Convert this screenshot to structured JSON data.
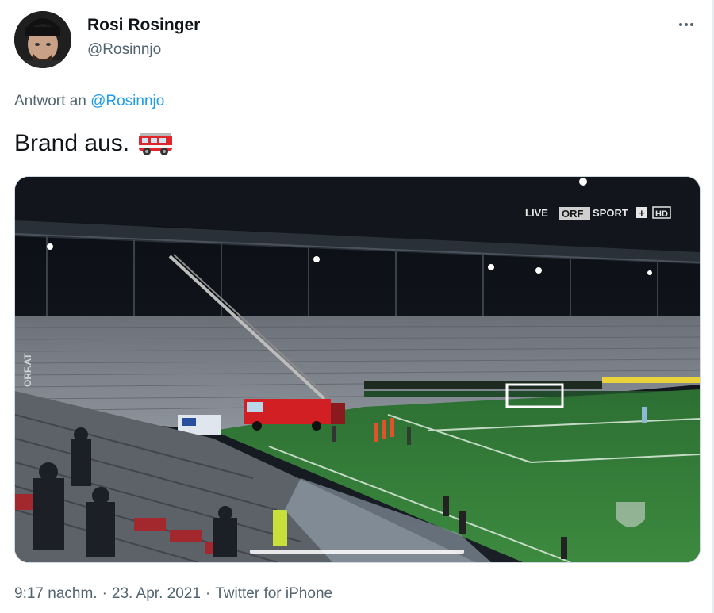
{
  "author": {
    "name": "Rosi Rosinger",
    "handle": "@Rosinnjo"
  },
  "reply": {
    "prefix": "Antwort an",
    "mention": "@Rosinnjo"
  },
  "tweet": {
    "text": "Brand aus.",
    "emoji": "fire-engine-icon"
  },
  "media": {
    "live_label": "LIVE",
    "broadcaster": "ORF",
    "channel": "SPORT",
    "plus": "+",
    "hd": "HD",
    "watermark": "ORF.AT",
    "progress": 0.5
  },
  "footer": {
    "time": "9:17 nachm.",
    "separator1": "·",
    "date": "23. Apr. 2021",
    "separator2": "·",
    "source": "Twitter for iPhone"
  },
  "colors": {
    "accent": "#1d9bf0",
    "secondary_text": "#536471",
    "pitch": "#2f7a36"
  }
}
